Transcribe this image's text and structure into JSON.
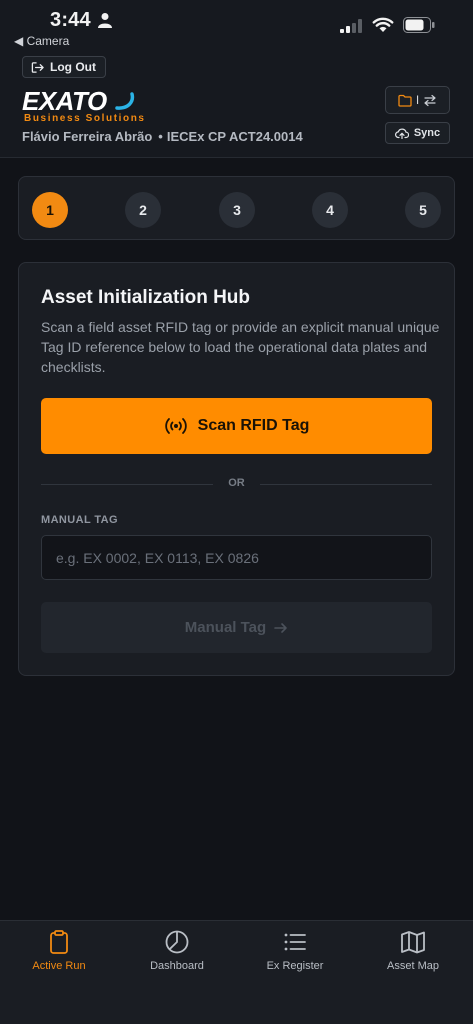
{
  "status_bar": {
    "time": "3:44",
    "back_app": "◀ Camera"
  },
  "header": {
    "logout_label": "Log Out",
    "logo_text": "EXATO",
    "logo_tagline": "Business Solutions",
    "user_name": "Flávio Ferreira Abrão",
    "dot": "•",
    "certificate": "IECEx CP ACT24.0014",
    "folder_divider": "I",
    "sync_label": "Sync"
  },
  "stepper": {
    "steps": [
      "1",
      "2",
      "3",
      "4",
      "5"
    ],
    "active_index": 0
  },
  "hub": {
    "title": "Asset Initialization Hub",
    "description": "Scan a field asset RFID tag or provide an explicit manual unique Tag ID reference below to load the operational data plates and checklists.",
    "scan_button": "Scan RFID Tag",
    "divider_text": "OR",
    "manual_tag_label": "MANUAL TAG",
    "manual_tag_placeholder": "e.g. EX 0002, EX 0113, EX 0826",
    "manual_tag_value": "",
    "manual_button": "Manual Tag"
  },
  "bottom_nav": {
    "items": [
      {
        "label": "Active Run",
        "icon": "clipboard-icon",
        "active": true
      },
      {
        "label": "Dashboard",
        "icon": "pie-chart-icon",
        "active": false
      },
      {
        "label": "Ex Register",
        "icon": "list-icon",
        "active": false
      },
      {
        "label": "Asset Map",
        "icon": "map-icon",
        "active": false
      }
    ]
  },
  "colors": {
    "accent": "#ff8c00",
    "background": "#111318",
    "surface": "#1a1d23"
  }
}
